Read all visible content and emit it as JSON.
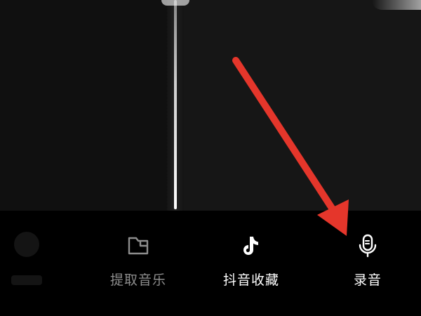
{
  "toolbar": {
    "extract_music_label": "提取音乐",
    "douyin_favorites_label": "抖音收藏",
    "record_label": "录音"
  },
  "icons": {
    "extract_music": "folder-icon",
    "douyin_favorites": "tiktok-note-icon",
    "record": "microphone-icon"
  },
  "colors": {
    "annotation_arrow": "#e5362b",
    "active_label": "#ffffff",
    "inactive_label": "#8d8d8d",
    "background": "#000000"
  }
}
